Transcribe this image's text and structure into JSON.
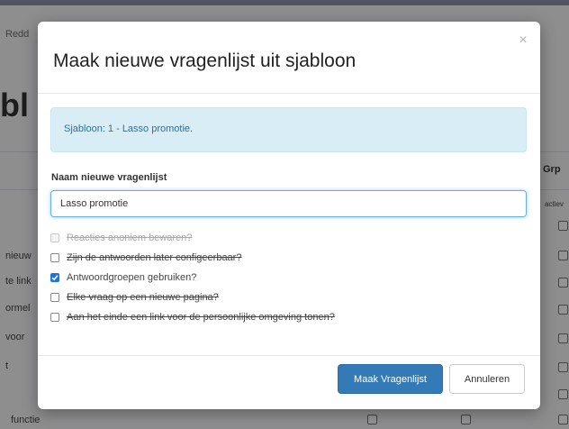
{
  "background": {
    "breadcrumb": "Redd",
    "page_title": "bl",
    "column_header": "Grp",
    "column_sub": "actiev",
    "row_labels": [
      "nieuw",
      "te link",
      "ormel",
      "voor",
      "t",
      "functie"
    ]
  },
  "modal": {
    "title": "Maak nieuwe vragenlijst uit sjabloon",
    "close_symbol": "×",
    "alert_text": "Sjabloon: 1 - Lasso promotie.",
    "name_label": "Naam nieuwe vragenlijst",
    "name_value": "Lasso promotie",
    "options": [
      {
        "label": "Reacties anoniem bewaren?",
        "checked": false,
        "disabled": true,
        "strike": true
      },
      {
        "label": "Zijn de antwoorden later configeerbaar?",
        "checked": false,
        "disabled": false,
        "strike": true
      },
      {
        "label": "Antwoordgroepen gebruiken?",
        "checked": true,
        "disabled": false,
        "strike": false
      },
      {
        "label": "Elke vraag op een nieuwe pagina?",
        "checked": false,
        "disabled": false,
        "strike": true
      },
      {
        "label": "Aan het einde een link voor de persoonlijke omgeving tonen?",
        "checked": false,
        "disabled": false,
        "strike": true
      }
    ],
    "submit_label": "Maak Vragenlijst",
    "cancel_label": "Annuleren"
  },
  "colors": {
    "primary": "#337ab7",
    "alert_bg": "#d9edf7",
    "alert_text": "#31708f",
    "checkbox_checked": "#1a73e8"
  }
}
